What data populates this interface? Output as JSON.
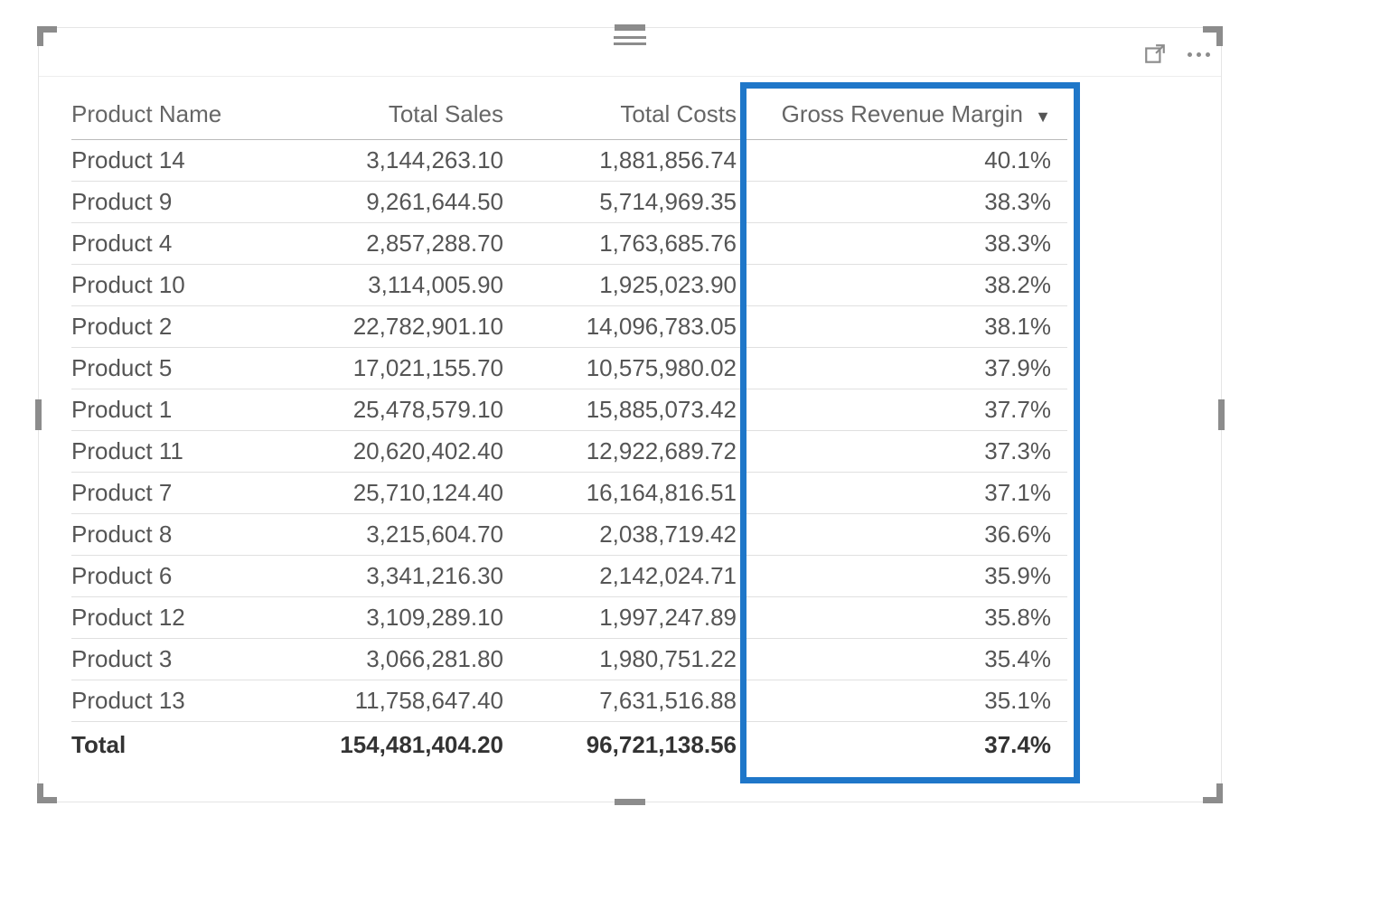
{
  "table": {
    "columns": [
      {
        "key": "name",
        "label": "Product Name",
        "align": "left",
        "sorted": false
      },
      {
        "key": "sales",
        "label": "Total Sales",
        "align": "right",
        "sorted": false
      },
      {
        "key": "costs",
        "label": "Total Costs",
        "align": "right",
        "sorted": false
      },
      {
        "key": "margin",
        "label": "Gross Revenue Margin",
        "align": "right",
        "sorted": true,
        "sort_dir": "desc"
      }
    ],
    "rows": [
      {
        "name": "Product 14",
        "sales": "3,144,263.10",
        "costs": "1,881,856.74",
        "margin": "40.1%"
      },
      {
        "name": "Product 9",
        "sales": "9,261,644.50",
        "costs": "5,714,969.35",
        "margin": "38.3%"
      },
      {
        "name": "Product 4",
        "sales": "2,857,288.70",
        "costs": "1,763,685.76",
        "margin": "38.3%"
      },
      {
        "name": "Product 10",
        "sales": "3,114,005.90",
        "costs": "1,925,023.90",
        "margin": "38.2%"
      },
      {
        "name": "Product 2",
        "sales": "22,782,901.10",
        "costs": "14,096,783.05",
        "margin": "38.1%"
      },
      {
        "name": "Product 5",
        "sales": "17,021,155.70",
        "costs": "10,575,980.02",
        "margin": "37.9%"
      },
      {
        "name": "Product 1",
        "sales": "25,478,579.10",
        "costs": "15,885,073.42",
        "margin": "37.7%"
      },
      {
        "name": "Product 11",
        "sales": "20,620,402.40",
        "costs": "12,922,689.72",
        "margin": "37.3%"
      },
      {
        "name": "Product 7",
        "sales": "25,710,124.40",
        "costs": "16,164,816.51",
        "margin": "37.1%"
      },
      {
        "name": "Product 8",
        "sales": "3,215,604.70",
        "costs": "2,038,719.42",
        "margin": "36.6%"
      },
      {
        "name": "Product 6",
        "sales": "3,341,216.30",
        "costs": "2,142,024.71",
        "margin": "35.9%"
      },
      {
        "name": "Product 12",
        "sales": "3,109,289.10",
        "costs": "1,997,247.89",
        "margin": "35.8%"
      },
      {
        "name": "Product 3",
        "sales": "3,066,281.80",
        "costs": "1,980,751.22",
        "margin": "35.4%"
      },
      {
        "name": "Product 13",
        "sales": "11,758,647.40",
        "costs": "7,631,516.88",
        "margin": "35.1%"
      }
    ],
    "total": {
      "label": "Total",
      "sales": "154,481,404.20",
      "costs": "96,721,138.56",
      "margin": "37.4%"
    }
  },
  "highlight_column_key": "margin",
  "chart_data": {
    "type": "table",
    "columns": [
      "Product Name",
      "Total Sales",
      "Total Costs",
      "Gross Revenue Margin"
    ],
    "rows": [
      [
        "Product 14",
        3144263.1,
        1881856.74,
        0.401
      ],
      [
        "Product 9",
        9261644.5,
        5714969.35,
        0.383
      ],
      [
        "Product 4",
        2857288.7,
        1763685.76,
        0.383
      ],
      [
        "Product 10",
        3114005.9,
        1925023.9,
        0.382
      ],
      [
        "Product 2",
        22782901.1,
        14096783.05,
        0.381
      ],
      [
        "Product 5",
        17021155.7,
        10575980.02,
        0.379
      ],
      [
        "Product 1",
        25478579.1,
        15885073.42,
        0.377
      ],
      [
        "Product 11",
        20620402.4,
        12922689.72,
        0.373
      ],
      [
        "Product 7",
        25710124.4,
        16164816.51,
        0.371
      ],
      [
        "Product 8",
        3215604.7,
        2038719.42,
        0.366
      ],
      [
        "Product 6",
        3341216.3,
        2142024.71,
        0.359
      ],
      [
        "Product 12",
        3109289.1,
        1997247.89,
        0.358
      ],
      [
        "Product 3",
        3066281.8,
        1980751.22,
        0.354
      ],
      [
        "Product 13",
        11758647.4,
        7631516.88,
        0.351
      ]
    ],
    "total": [
      "Total",
      154481404.2,
      96721138.56,
      0.374
    ],
    "sorted_by": "Gross Revenue Margin",
    "sort_dir": "desc"
  }
}
